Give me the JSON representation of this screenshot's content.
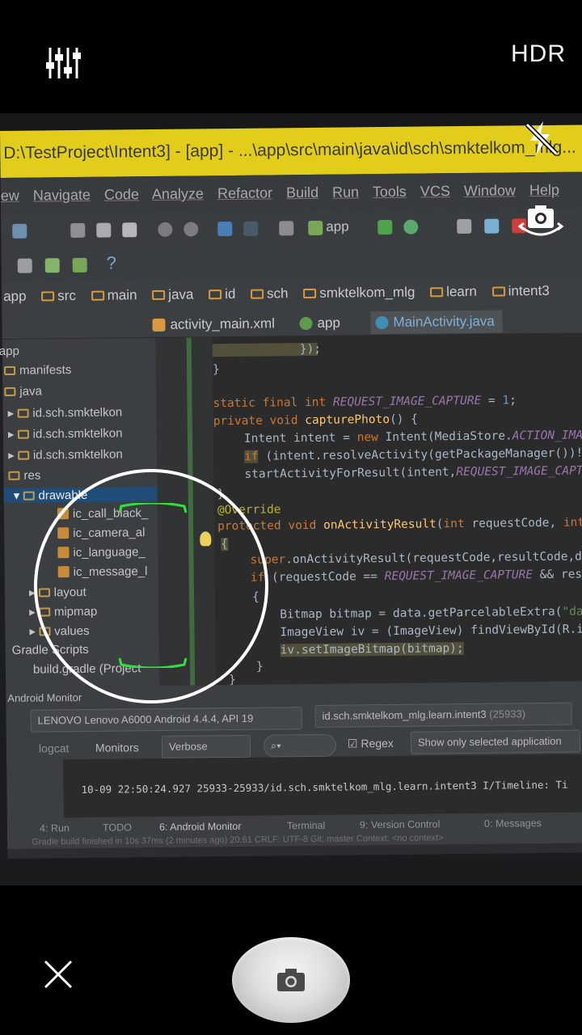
{
  "camera": {
    "hdr_label": "HDR",
    "settings_icon": "sliders-icon",
    "flash_icon": "flash-off-icon",
    "switch_icon": "switch-camera-icon",
    "close_icon": "close-icon",
    "shutter_icon": "camera-icon"
  },
  "scene": {
    "title_bar": "D:\\TestProject\\Intent3] - [app] - ...\\app\\src\\main\\java\\id\\sch\\smktelkom_mlg...",
    "menu": [
      "ew",
      "Navigate",
      "Code",
      "Analyze",
      "Refactor",
      "Build",
      "Run",
      "Tools",
      "VCS",
      "Window",
      "Help"
    ],
    "toolbar_run_config": "app",
    "breadcrumb": [
      "app",
      "src",
      "main",
      "java",
      "id",
      "sch",
      "smktelkom_mlg",
      "learn",
      "intent3"
    ],
    "tabs": [
      "activity_main.xml",
      "app",
      "MainActivity.java"
    ],
    "project_tree": [
      "app",
      "manifests",
      "java",
      "id.sch.smktelkon",
      "id.sch.smktelkon",
      "id.sch.smktelkon",
      "res",
      "drawable",
      "ic_call_black_",
      "ic_camera_al",
      "ic_language_",
      "ic_message_l",
      "layout",
      "mipmap",
      "values",
      "Gradle Scripts",
      "build.gradle (Project"
    ],
    "code_lines": [
      "});",
      "}",
      "static final int REQUEST_IMAGE_CAPTURE = 1;",
      "private void capturePhoto() {",
      "Intent intent = new Intent(MediaStore.ACTION_IMA",
      "if (intent.resolveActivity(getPackageManager())!",
      "startActivityForResult(intent,REQUEST_IMAGE_CAPT",
      "}",
      "@Override",
      "protected void onActivityResult(int requestCode, int",
      "{",
      "super.onActivityResult(requestCode,resultCode,dat",
      "if (requestCode == REQUEST_IMAGE_CAPTURE && resul",
      "{",
      "Bitmap bitmap = data.getParcelableExtra(\"data",
      "ImageView iv = (ImageView) findViewById(R.id.",
      "iv.setImageBitmap(bitmap);",
      "}",
      "}"
    ],
    "monitor_title": "Android Monitor",
    "device": "LENOVO Lenovo A6000 Android 4.4.4, API 19",
    "process": "id.sch.smktelkom_mlg.learn.intent3",
    "process_pid": "(25933)",
    "logcat_tab": "logcat",
    "monitors_tab": "Monitors",
    "log_level": "Verbose",
    "regex_label": "Regex",
    "filter_label": "Show only selected application",
    "log_line": "10-09 22:50:24.927 25933-25933/id.sch.smktelkom_mlg.learn.intent3 I/Timeline: Ti",
    "bottom_tabs": [
      "4: Run",
      "TODO",
      "6: Android Monitor",
      "Terminal",
      "9: Version Control",
      "0: Messages"
    ],
    "status_line": "Gradle build finished in 10s 37ms (2 minutes ago)   20:61   CRLF:   UTF-8   Git: master   Context: <no context>"
  }
}
